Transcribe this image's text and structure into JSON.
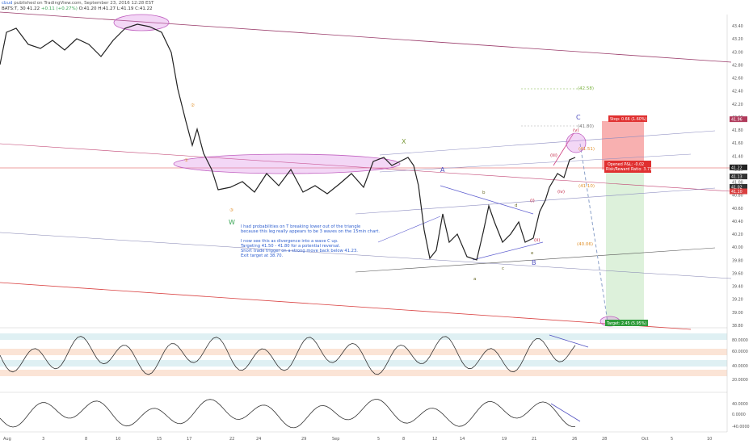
{
  "header": {
    "user": "cbud",
    "published": "published on TradingView.com, September 23, 2016 12:28 EST",
    "ticker_line": "BATS:T, 30  41.22",
    "change": "+0.11 (+0.27%)",
    "ohlc": "O:41.20 H:41.27 L:41.19 C:41.22"
  },
  "annotation_note": [
    "I had probabilities on T breaking lower out of the triangle",
    "because this leg really appears to be 3 waves on the 15min chart.",
    "",
    "I now see this as divergence into a wave C up.",
    "Targeting 41.50 - 41.80 for a potential reversal.",
    "Short trade trigger on a strong move back below 41.23.",
    "Exit target at 38.70."
  ],
  "chart_data": [
    {
      "type": "line",
      "name": "price",
      "y_ticks": [
        "43.40",
        "43.20",
        "43.00",
        "42.80",
        "42.60",
        "42.40",
        "42.20",
        "42.00",
        "41.80",
        "41.60",
        "41.40",
        "41.20",
        "41.00",
        "40.80",
        "40.60",
        "40.40",
        "40.20",
        "40.00",
        "39.80",
        "39.60",
        "39.40",
        "39.20",
        "39.00",
        "38.80"
      ],
      "x_ticks": [
        "Aug",
        "3",
        "8",
        "10",
        "15",
        "17",
        "22",
        "24",
        "29",
        "Sep",
        "5",
        "8",
        "12",
        "14",
        "19",
        "21",
        "26",
        "28",
        "Oct",
        "5",
        "10"
      ],
      "price_tags": [
        "41.96",
        "41.22",
        "41.13",
        "41.02",
        "41.10"
      ],
      "labels": [
        "①",
        "②",
        "③",
        "W",
        "X",
        "A",
        "B",
        "C",
        "a",
        "b",
        "c",
        "d",
        "e",
        "(i)",
        "(ii)",
        "(iii)",
        "(iv)",
        "(v)",
        "(42.58)",
        "(41.80)",
        "(41.51)",
        "(41.10)",
        "(40.06)"
      ],
      "position_box": {
        "stop": "Stop: 0.66 (1.60%)",
        "opened_pnl": "Opened P&L: -0.02",
        "risk_reward": "Risk/Reward Ratio: 3.71",
        "target": "Target: 2.45 (5.95%)"
      }
    },
    {
      "type": "line",
      "name": "oscillator-1",
      "y_ticks": [
        "80.0000",
        "60.0000",
        "40.0000",
        "20.0000"
      ]
    },
    {
      "type": "line",
      "name": "oscillator-2",
      "y_ticks": [
        "40.0000",
        "0.0000",
        "-40.0000"
      ]
    }
  ]
}
